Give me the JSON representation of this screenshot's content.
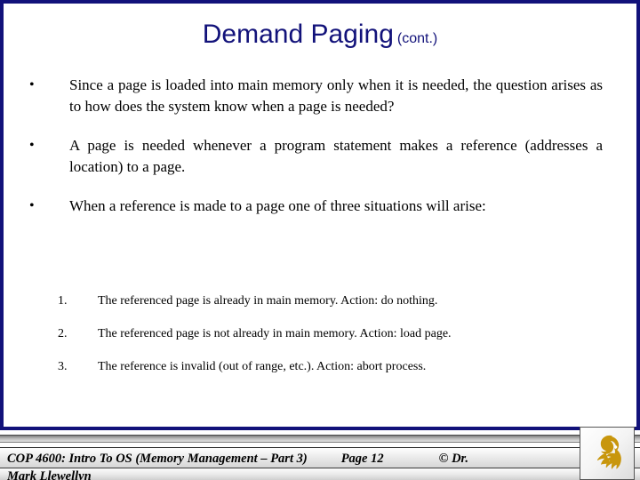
{
  "slide": {
    "title": "Demand Paging",
    "title_suffix": "(cont.)",
    "accent_color": "#12127a",
    "background_color": "#ffffff"
  },
  "bullets": [
    {
      "marker": "•",
      "text": "Since a page is loaded into main memory only when it is needed, the question arises as to how does the system know when a page is needed?"
    },
    {
      "marker": "•",
      "text": "A page is needed whenever a program statement makes a reference (addresses a location) to a page."
    },
    {
      "marker": "•",
      "text": "When a reference is made to a page one of three situations will arise:"
    }
  ],
  "numbered_items": [
    {
      "marker": "1.",
      "text": "The referenced page is already in main memory.  Action: do nothing."
    },
    {
      "marker": "2.",
      "text": "The referenced page is not already in main memory.  Action: load page."
    },
    {
      "marker": "3.",
      "text": "The reference is invalid (out of range, etc.).  Action: abort process."
    }
  ],
  "footer": {
    "course": "COP 4600: Intro To OS  (Memory Management – Part 3)",
    "page": "Page 12",
    "copyright": "© Dr.",
    "author": "Mark Llewellyn",
    "logo_name": "ucf-pegasus-logo",
    "logo_color": "#c8960c"
  }
}
